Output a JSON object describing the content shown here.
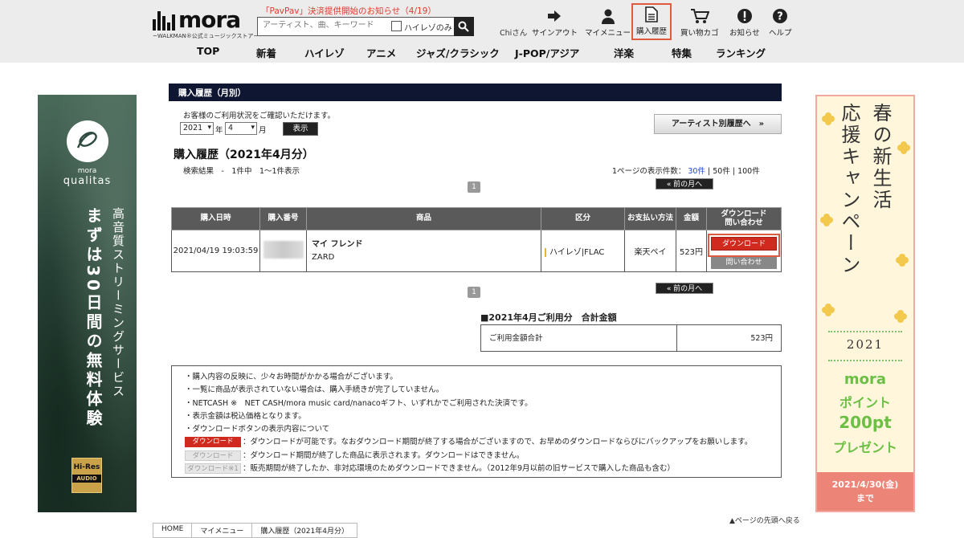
{
  "header": {
    "logo_word": "mora",
    "logo_sub": "~WALKMAN®公式ミュージックストア~",
    "notice": "「PavPav」決済提供開始のお知らせ（4/19）",
    "search_placeholder": "アーティスト、曲、キーワード",
    "hires_only_label": "ハイレゾのみ",
    "user_name": "Chiさん",
    "nav_buttons": [
      {
        "label": "サインアウト",
        "icon": "signout-icon"
      },
      {
        "label": "マイメニュー",
        "icon": "person-icon"
      },
      {
        "label": "購入履歴",
        "icon": "document-icon"
      },
      {
        "label": "買い物カゴ",
        "icon": "cart-icon"
      },
      {
        "label": "お知らせ",
        "icon": "alert-icon"
      },
      {
        "label": "ヘルプ",
        "icon": "help-icon"
      }
    ],
    "genre_nav": [
      "TOP",
      "新着",
      "ハイレゾ",
      "アニメ",
      "ジャズ/クラシック",
      "J-POP/アジア",
      "洋楽",
      "特集",
      "ランキング"
    ]
  },
  "left_banner": {
    "brand": "mora",
    "product": "qualitas",
    "tagline": "高音質ストリーミングサービス",
    "offer": "まずは30日間の無料体験",
    "badge_top": "Hi-Res",
    "badge_bottom": "AUDIO"
  },
  "right_banner": {
    "title_col1": "春の新生活",
    "title_col2": "応援キャンペーン",
    "year": "2021",
    "points_brand": "mora",
    "points_line1": "ポイント",
    "points_line2": "200pt",
    "points_line3": "プレゼント",
    "deadline": "2021/4/30(金)",
    "deadline_suffix": "まで"
  },
  "main": {
    "section_title": "購入履歴（月別）",
    "intro": "お客様のご利用状況をご確認いただけます。",
    "year_value": "2021",
    "year_label": "年",
    "month_value": "4",
    "month_label": "月",
    "show_button": "表示",
    "artist_button": "アーティスト別履歴へ　»",
    "heading": "購入履歴（2021年4月分）",
    "result_text": "検索結果　-　1件中　1〜1件表示",
    "per_page_label": "1ページの表示件数：",
    "per_page_30": "30件",
    "per_page_50": "50件",
    "per_page_100": "100件",
    "page_number": "1",
    "prev_month": "« 前の月へ",
    "table_headers": [
      "購入日時",
      "購入番号",
      "商品",
      "区分",
      "お支払い方法",
      "金額",
      "ダウンロード\n問い合わせ"
    ],
    "row": {
      "date": "2021/04/19 19:03:59",
      "title": "マイ フレンド",
      "artist": "ZARD",
      "category": "ハイレゾ|FLAC",
      "payment": "楽天ペイ",
      "price": "523円",
      "download": "ダウンロード",
      "inquiry": "問い合わせ"
    },
    "summary_title": "■2021年4月ご利用分　合計金額",
    "summary_label": "ご利用金額合計",
    "summary_value": "523円",
    "notes": [
      "・購入内容の反映に、少々お時間がかかる場合がございます。",
      "・一覧に商品が表示されていない場合は、購入手続きが完了していません。",
      "・NETCASH ※　NET CASH/mora music card/nanacoギフト、いずれかでご利用された決済です。",
      "・表示金額は税込価格となります。",
      "・ダウンロードボタンの表示内容について"
    ],
    "legend": [
      {
        "btn": "ダウンロード",
        "text": "：ダウンロードが可能です。なおダウンロード期間が終了する場合がございますので、お早めのダウンロードならびにバックアップをお願いします。"
      },
      {
        "btn": "ダウンロード",
        "text": "：ダウンロード期間が終了した商品に表示されます。ダウンロードはできません。"
      },
      {
        "btn": "ダウンロード※1",
        "text": "：販売期間が終了したか、非対応環境のためダウンロードできません。（2012年9月以前の旧サービスで購入した商品も含む）"
      }
    ]
  },
  "breadcrumb": [
    "HOME",
    "マイメニュー",
    "購入履歴（2021年4月分）"
  ],
  "to_top": "▲ページの先頭へ戻る",
  "colors": {
    "header_bg": "#ececec",
    "section_bar": "#0f1632",
    "download_red": "#d02a1f",
    "highlight": "#e05a3f"
  }
}
